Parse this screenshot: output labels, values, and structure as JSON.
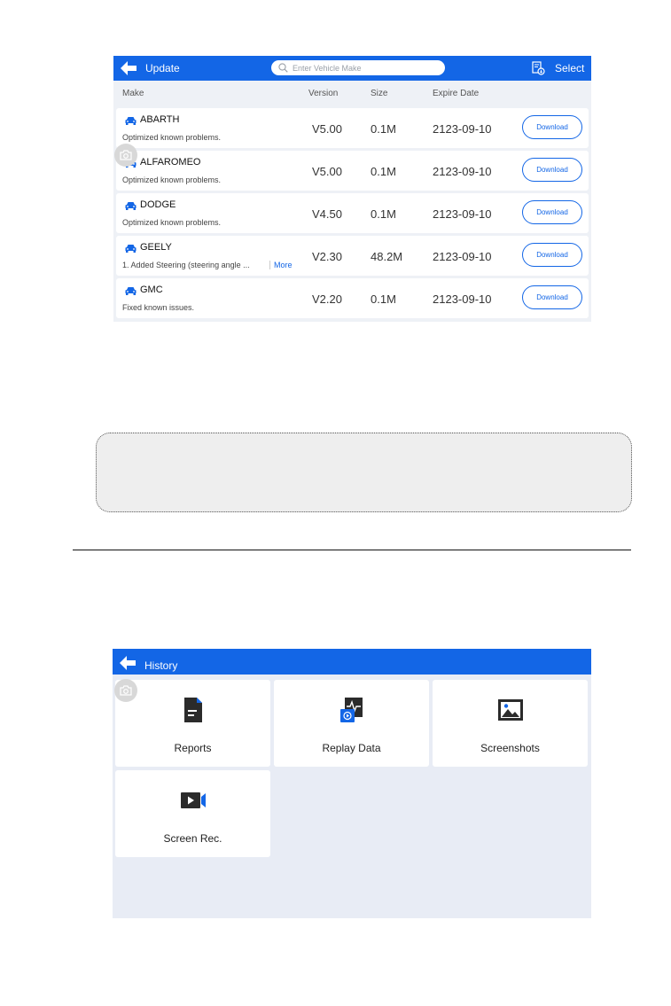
{
  "update": {
    "title": "Update",
    "search_placeholder": "Enter Vehicle Make",
    "select_label": "Select",
    "columns": {
      "make": "Make",
      "version": "Version",
      "size": "Size",
      "expire": "Expire Date"
    },
    "rows": [
      {
        "make": "ABARTH",
        "desc": "Optimized known problems.",
        "more": "",
        "version": "V5.00",
        "size": "0.1M",
        "expire": "2123-09-10",
        "action": "Download"
      },
      {
        "make": "ALFAROMEO",
        "desc": "Optimized known problems.",
        "more": "",
        "version": "V5.00",
        "size": "0.1M",
        "expire": "2123-09-10",
        "action": "Download"
      },
      {
        "make": "DODGE",
        "desc": "Optimized known problems.",
        "more": "",
        "version": "V4.50",
        "size": "0.1M",
        "expire": "2123-09-10",
        "action": "Download"
      },
      {
        "make": "GEELY",
        "desc": "1. Added Steering (steering angle ...",
        "more": "More",
        "version": "V2.30",
        "size": "48.2M",
        "expire": "2123-09-10",
        "action": "Download"
      },
      {
        "make": "GMC",
        "desc": "Fixed known issues.",
        "more": "",
        "version": "V2.20",
        "size": "0.1M",
        "expire": "2123-09-10",
        "action": "Download"
      }
    ]
  },
  "history": {
    "title": "History",
    "tiles": [
      {
        "label": "Reports",
        "icon": "report-document-icon"
      },
      {
        "label": "Replay Data",
        "icon": "replay-data-icon"
      },
      {
        "label": "Screenshots",
        "icon": "image-icon"
      },
      {
        "label": "Screen Rec.",
        "icon": "video-camera-icon"
      }
    ]
  },
  "colors": {
    "accent": "#1366e6",
    "screen_bg": "#eef1f6",
    "history_bg": "#e8ecf5",
    "icon_dark": "#2b2b2b"
  }
}
